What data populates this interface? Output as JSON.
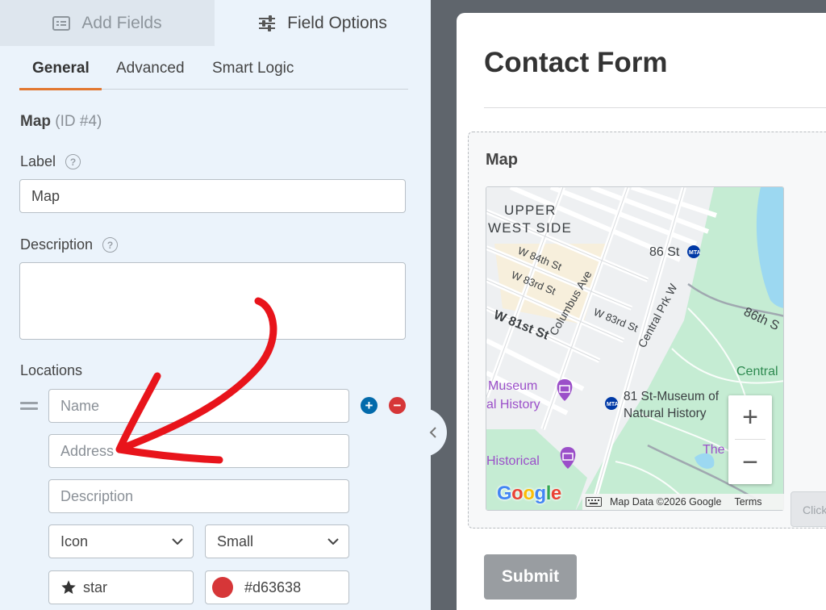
{
  "panel_tabs": {
    "add_fields": "Add Fields",
    "field_options": "Field Options"
  },
  "sub_tabs": {
    "general": "General",
    "advanced": "Advanced",
    "smart_logic": "Smart Logic"
  },
  "field": {
    "name": "Map",
    "id_text": "(ID #4)"
  },
  "label_section": {
    "title": "Label",
    "value": "Map"
  },
  "description_section": {
    "title": "Description",
    "value": ""
  },
  "locations": {
    "title": "Locations",
    "name_placeholder": "Name",
    "address_placeholder": "Address",
    "description_placeholder": "Description",
    "icon_select": "Icon",
    "size_select": "Small",
    "icon_value": "star",
    "color_value": "#d63638"
  },
  "preview": {
    "form_title": "Contact Form",
    "map_label": "Map",
    "submit_label": "Submit",
    "click_stub": "Click"
  },
  "map": {
    "labels": {
      "upper": "UPPER",
      "west_side": "WEST SIDE",
      "w84": "W 84th St",
      "w83a": "W 83rd St",
      "columbus": "Columbus Ave",
      "w83b": "W 83rd St",
      "w81": "W 81st St",
      "central_prk": "Central Prk W",
      "st86": "86 St",
      "st86th": "86th S",
      "central": "Central",
      "museum1": "Museum",
      "history1": "al History",
      "st81_1": "81 St-Museum of",
      "st81_2": "Natural History",
      "the": "The",
      "historical": "Historical",
      "m": "M",
      "mta": "MTA"
    },
    "google_letters": [
      "G",
      "o",
      "o",
      "g",
      "l",
      "e"
    ],
    "footer": {
      "data_text": "Map Data ©2026 Google",
      "terms": "Terms"
    },
    "zoom_in": "+",
    "zoom_out": "−"
  },
  "colors": {
    "accent_orange": "#e27730",
    "add_blue": "#036aab",
    "remove_red": "#d63638",
    "arrow_red": "#e8141b",
    "park_green": "#c5ecd3",
    "water_blue": "#9cd8f1",
    "museum_purple": "#9b4fc9"
  },
  "icons": [
    "fields-list-icon",
    "sliders-icon",
    "help-icon",
    "drag-handle-icon",
    "add-location-icon",
    "remove-location-icon",
    "chevron-down-icon",
    "star-icon",
    "color-swatch-icon",
    "collapse-chevron-icon",
    "keyboard-icon",
    "museum-icon",
    "subway-icon"
  ]
}
